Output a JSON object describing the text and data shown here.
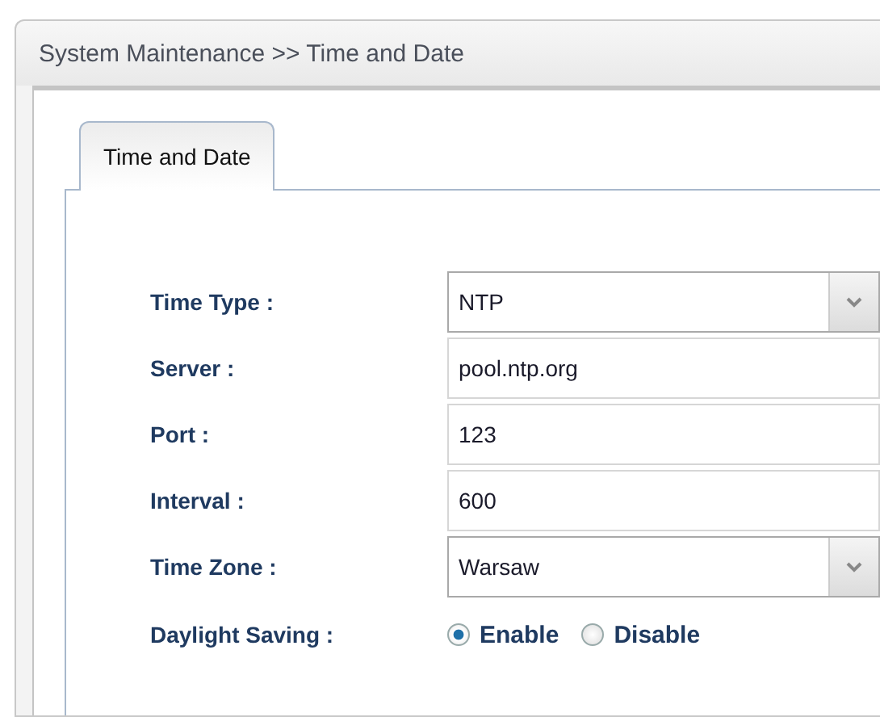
{
  "header": {
    "title": "System Maintenance >> Time and Date"
  },
  "tabs": [
    {
      "label": "Time and Date",
      "selected": true
    }
  ],
  "fields": [
    {
      "kind": "select",
      "label": "Time Type :",
      "value": "NTP"
    },
    {
      "kind": "text",
      "label": "Server :",
      "value": "pool.ntp.org"
    },
    {
      "kind": "text",
      "label": "Port :",
      "value": "123"
    },
    {
      "kind": "text",
      "label": "Interval :",
      "value": "600"
    },
    {
      "kind": "select",
      "label": "Time Zone :",
      "value": "Warsaw"
    },
    {
      "kind": "radio",
      "label": "Daylight Saving :",
      "options": [
        {
          "label": "Enable",
          "selected": true
        },
        {
          "label": "Disable",
          "selected": false
        }
      ]
    }
  ]
}
